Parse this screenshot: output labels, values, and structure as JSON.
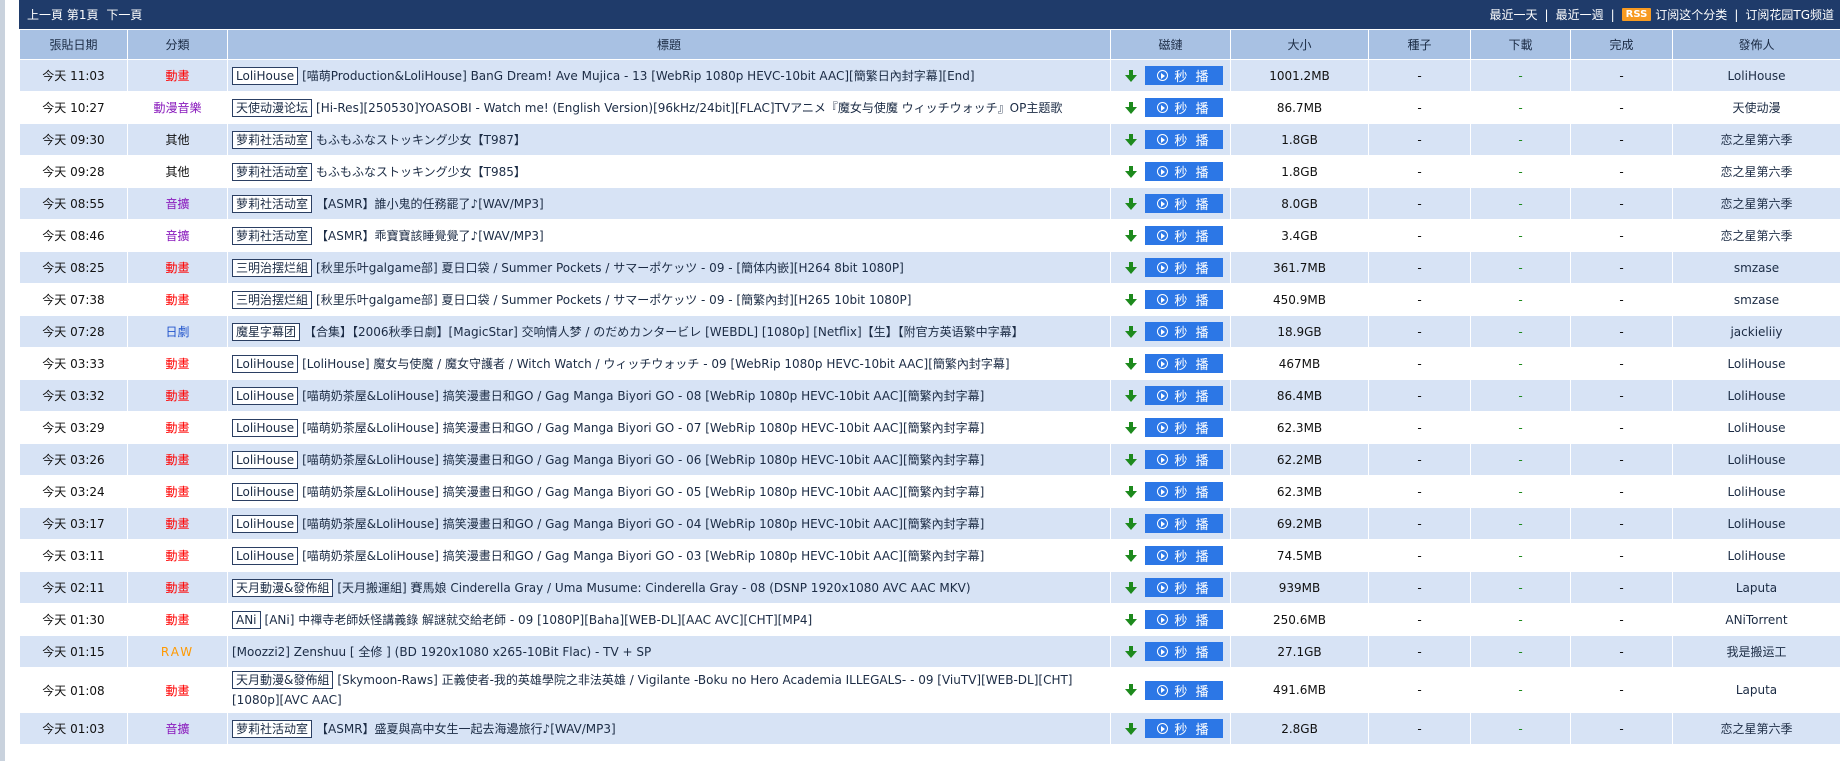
{
  "nav": {
    "prev": "上一頁",
    "page": "第1頁",
    "next": "下一頁",
    "recent_day": "最近一天",
    "recent_week": "最近一週",
    "rss": "RSS",
    "subscribe_category": "订阅这个分类",
    "subscribe_tg": "订阅花园TG频道"
  },
  "headers": [
    "張貼日期",
    "分類",
    "標題",
    "磁鏈",
    "大小",
    "種子",
    "下載",
    "完成",
    "發佈人"
  ],
  "colors": {
    "anime": "#ff0000",
    "music": "#8a1bbd",
    "other": "#111111",
    "drama": "#2255cc",
    "raw": "#ff9900",
    "header_bg": "#1f3b6a"
  },
  "play_label": "秒 播",
  "rows": [
    {
      "date": "今天 11:03",
      "category": "動畫",
      "cat_color": "#ff0000",
      "tag": "LoliHouse",
      "title": "[喵萌Production&LoliHouse] BanG Dream! Ave Mujica - 13 [WebRip 1080p HEVC-10bit AAC][簡繁日內封字幕][End]",
      "size": "1001.2MB",
      "seeds": "-",
      "downloads": "-",
      "completed": "-",
      "uploader": "LoliHouse"
    },
    {
      "date": "今天 10:27",
      "category": "動漫音樂",
      "cat_color": "#8a1bbd",
      "tag": "天使动漫论坛",
      "title": "[Hi-Res][250530]YOASOBI - Watch me! (English Version)[96kHz/24bit][FLAC]TVアニメ『魔女与使魔 ウィッチウォッチ』OP主题歌",
      "size": "86.7MB",
      "seeds": "-",
      "downloads": "-",
      "completed": "-",
      "uploader": "天使动漫"
    },
    {
      "date": "今天 09:30",
      "category": "其他",
      "cat_color": "#111111",
      "tag": "萝莉社活动室",
      "title": "もふもふなストッキング少女【T987】",
      "size": "1.8GB",
      "seeds": "-",
      "downloads": "-",
      "completed": "-",
      "uploader": "恋之星第六季"
    },
    {
      "date": "今天 09:28",
      "category": "其他",
      "cat_color": "#111111",
      "tag": "萝莉社活动室",
      "title": "もふもふなストッキング少女【T985】",
      "size": "1.8GB",
      "seeds": "-",
      "downloads": "-",
      "completed": "-",
      "uploader": "恋之星第六季"
    },
    {
      "date": "今天 08:55",
      "category": "音擴",
      "cat_color": "#8a1bbd",
      "tag": "萝莉社活动室",
      "title": "【ASMR】誰小鬼的任務罷了♪[WAV/MP3]",
      "size": "8.0GB",
      "seeds": "-",
      "downloads": "-",
      "completed": "-",
      "uploader": "恋之星第六季"
    },
    {
      "date": "今天 08:46",
      "category": "音擴",
      "cat_color": "#8a1bbd",
      "tag": "萝莉社活动室",
      "title": "【ASMR】乖寶寶該睡覺覺了♪[WAV/MP3]",
      "size": "3.4GB",
      "seeds": "-",
      "downloads": "-",
      "completed": "-",
      "uploader": "恋之星第六季"
    },
    {
      "date": "今天 08:25",
      "category": "動畫",
      "cat_color": "#ff0000",
      "tag": "三明治摆烂組",
      "title": "[秋里乐叶galgame部] 夏日口袋 / Summer Pockets / サマーポケッツ - 09 - [簡体内嵌][H264 8bit 1080P]",
      "size": "361.7MB",
      "seeds": "-",
      "downloads": "-",
      "completed": "-",
      "uploader": "smzase"
    },
    {
      "date": "今天 07:38",
      "category": "動畫",
      "cat_color": "#ff0000",
      "tag": "三明治摆烂組",
      "title": "[秋里乐叶galgame部] 夏日口袋 / Summer Pockets / サマーポケッツ - 09 - [簡繁內封][H265 10bit 1080P]",
      "size": "450.9MB",
      "seeds": "-",
      "downloads": "-",
      "completed": "-",
      "uploader": "smzase"
    },
    {
      "date": "今天 07:28",
      "category": "日劇",
      "cat_color": "#2255cc",
      "tag": "魔星字幕团",
      "title": "【合集】【2006秋季日劇】[MagicStar] 交响情人梦 / のだめカンタービレ [WEBDL] [1080p] [Netflix]【生】【附官方英语繁中字幕】",
      "size": "18.9GB",
      "seeds": "-",
      "downloads": "-",
      "completed": "-",
      "uploader": "jackieliiy"
    },
    {
      "date": "今天 03:33",
      "category": "動畫",
      "cat_color": "#ff0000",
      "tag": "LoliHouse",
      "title": "[LoliHouse] 魔女与使魔 / 魔女守護者 / Witch Watch / ウィッチウォッチ - 09 [WebRip 1080p HEVC-10bit AAC][簡繁內封字幕]",
      "size": "467MB",
      "seeds": "-",
      "downloads": "-",
      "completed": "-",
      "uploader": "LoliHouse"
    },
    {
      "date": "今天 03:32",
      "category": "動畫",
      "cat_color": "#ff0000",
      "tag": "LoliHouse",
      "title": "[喵萌奶茶屋&LoliHouse] 搞笑漫畫日和GO / Gag Manga Biyori GO - 08 [WebRip 1080p HEVC-10bit AAC][簡繁內封字幕]",
      "size": "86.4MB",
      "seeds": "-",
      "downloads": "-",
      "completed": "-",
      "uploader": "LoliHouse"
    },
    {
      "date": "今天 03:29",
      "category": "動畫",
      "cat_color": "#ff0000",
      "tag": "LoliHouse",
      "title": "[喵萌奶茶屋&LoliHouse] 搞笑漫畫日和GO / Gag Manga Biyori GO - 07 [WebRip 1080p HEVC-10bit AAC][簡繁內封字幕]",
      "size": "62.3MB",
      "seeds": "-",
      "downloads": "-",
      "completed": "-",
      "uploader": "LoliHouse"
    },
    {
      "date": "今天 03:26",
      "category": "動畫",
      "cat_color": "#ff0000",
      "tag": "LoliHouse",
      "title": "[喵萌奶茶屋&LoliHouse] 搞笑漫畫日和GO / Gag Manga Biyori GO - 06 [WebRip 1080p HEVC-10bit AAC][簡繁內封字幕]",
      "size": "62.2MB",
      "seeds": "-",
      "downloads": "-",
      "completed": "-",
      "uploader": "LoliHouse"
    },
    {
      "date": "今天 03:24",
      "category": "動畫",
      "cat_color": "#ff0000",
      "tag": "LoliHouse",
      "title": "[喵萌奶茶屋&LoliHouse] 搞笑漫畫日和GO / Gag Manga Biyori GO - 05 [WebRip 1080p HEVC-10bit AAC][簡繁內封字幕]",
      "size": "62.3MB",
      "seeds": "-",
      "downloads": "-",
      "completed": "-",
      "uploader": "LoliHouse"
    },
    {
      "date": "今天 03:17",
      "category": "動畫",
      "cat_color": "#ff0000",
      "tag": "LoliHouse",
      "title": "[喵萌奶茶屋&LoliHouse] 搞笑漫畫日和GO / Gag Manga Biyori GO - 04 [WebRip 1080p HEVC-10bit AAC][簡繁內封字幕]",
      "size": "69.2MB",
      "seeds": "-",
      "downloads": "-",
      "completed": "-",
      "uploader": "LoliHouse"
    },
    {
      "date": "今天 03:11",
      "category": "動畫",
      "cat_color": "#ff0000",
      "tag": "LoliHouse",
      "title": "[喵萌奶茶屋&LoliHouse] 搞笑漫畫日和GO / Gag Manga Biyori GO - 03 [WebRip 1080p HEVC-10bit AAC][簡繁內封字幕]",
      "size": "74.5MB",
      "seeds": "-",
      "downloads": "-",
      "completed": "-",
      "uploader": "LoliHouse"
    },
    {
      "date": "今天 02:11",
      "category": "動畫",
      "cat_color": "#ff0000",
      "tag": "天月動漫&發佈組",
      "title": "[天月搬運組] 賽馬娘 Cinderella Gray / Uma Musume: Cinderella Gray - 08 (DSNP 1920x1080 AVC AAC MKV)",
      "size": "939MB",
      "seeds": "-",
      "downloads": "-",
      "completed": "-",
      "uploader": "Laputa"
    },
    {
      "date": "今天 01:30",
      "category": "動畫",
      "cat_color": "#ff0000",
      "tag": "ANi",
      "title": "[ANi] 中禪寺老師妖怪講義錄 解謎就交給老師 - 09 [1080P][Baha][WEB-DL][AAC AVC][CHT][MP4]",
      "size": "250.6MB",
      "seeds": "-",
      "downloads": "-",
      "completed": "-",
      "uploader": "ANiTorrent"
    },
    {
      "date": "今天 01:15",
      "category": "RAW",
      "cat_color": "#ff9900",
      "tag": "",
      "title": "[Moozzi2] Zenshuu [ 全修 ] (BD 1920x1080 x265-10Bit Flac) - TV + SP",
      "size": "27.1GB",
      "seeds": "-",
      "downloads": "-",
      "completed": "-",
      "uploader": "我是搬运工"
    },
    {
      "date": "今天 01:08",
      "category": "動畫",
      "cat_color": "#ff0000",
      "tag": "天月動漫&發佈組",
      "title": "[Skymoon-Raws] 正義使者-我的英雄學院之非法英雄 / Vigilante -Boku no Hero Academia ILLEGALS- - 09 [ViuTV][WEB-DL][CHT][1080p][AVC AAC]",
      "size": "491.6MB",
      "seeds": "-",
      "downloads": "-",
      "completed": "-",
      "uploader": "Laputa",
      "tall": true
    },
    {
      "date": "今天 01:03",
      "category": "音擴",
      "cat_color": "#8a1bbd",
      "tag": "萝莉社活动室",
      "title": "【ASMR】盛夏與高中女生一起去海邊旅行♪[WAV/MP3]",
      "size": "2.8GB",
      "seeds": "-",
      "downloads": "-",
      "completed": "-",
      "uploader": "恋之星第六季"
    }
  ]
}
